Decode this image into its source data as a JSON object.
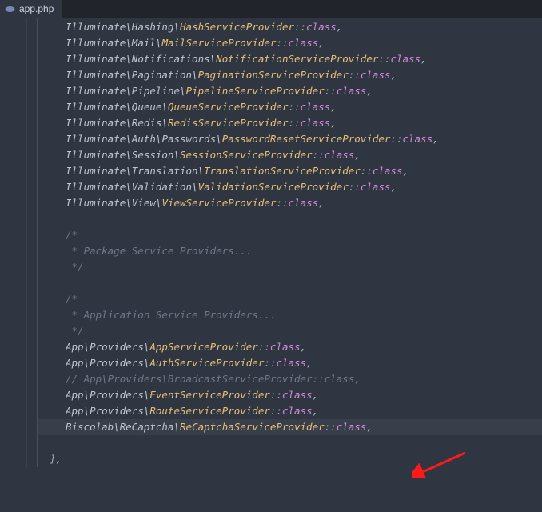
{
  "tab": {
    "filename": "app.php"
  },
  "lines": [
    {
      "ns": "Illuminate\\Hashing\\",
      "cls": "HashServiceProvider",
      "tail": "::",
      "kw": "class",
      "end": ","
    },
    {
      "ns": "Illuminate\\Mail\\",
      "cls": "MailServiceProvider",
      "tail": "::",
      "kw": "class",
      "end": ","
    },
    {
      "ns": "Illuminate\\Notifications\\",
      "cls": "NotificationServiceProvider",
      "tail": "::",
      "kw": "class",
      "end": ","
    },
    {
      "ns": "Illuminate\\Pagination\\",
      "cls": "PaginationServiceProvider",
      "tail": "::",
      "kw": "class",
      "end": ","
    },
    {
      "ns": "Illuminate\\Pipeline\\",
      "cls": "PipelineServiceProvider",
      "tail": "::",
      "kw": "class",
      "end": ","
    },
    {
      "ns": "Illuminate\\Queue\\",
      "cls": "QueueServiceProvider",
      "tail": "::",
      "kw": "class",
      "end": ","
    },
    {
      "ns": "Illuminate\\Redis\\",
      "cls": "RedisServiceProvider",
      "tail": "::",
      "kw": "class",
      "end": ","
    },
    {
      "ns": "Illuminate\\Auth\\Passwords\\",
      "cls": "PasswordResetServiceProvider",
      "tail": "::",
      "kw": "class",
      "end": ","
    },
    {
      "ns": "Illuminate\\Session\\",
      "cls": "SessionServiceProvider",
      "tail": "::",
      "kw": "class",
      "end": ","
    },
    {
      "ns": "Illuminate\\Translation\\",
      "cls": "TranslationServiceProvider",
      "tail": "::",
      "kw": "class",
      "end": ","
    },
    {
      "ns": "Illuminate\\Validation\\",
      "cls": "ValidationServiceProvider",
      "tail": "::",
      "kw": "class",
      "end": ","
    },
    {
      "ns": "Illuminate\\View\\",
      "cls": "ViewServiceProvider",
      "tail": "::",
      "kw": "class",
      "end": ","
    }
  ],
  "comment1": {
    "a": "/*",
    "b": " * Package Service Providers...",
    "c": " */"
  },
  "comment2": {
    "a": "/*",
    "b": " * Application Service Providers...",
    "c": " */"
  },
  "appLines": [
    {
      "ns": "App\\Providers\\",
      "cls": "AppServiceProvider",
      "tail": "::",
      "kw": "class",
      "end": ","
    },
    {
      "ns": "App\\Providers\\",
      "cls": "AuthServiceProvider",
      "tail": "::",
      "kw": "class",
      "end": ","
    }
  ],
  "commentedLine": "// App\\Providers\\BroadcastServiceProvider::class,",
  "appLines2": [
    {
      "ns": "App\\Providers\\",
      "cls": "EventServiceProvider",
      "tail": "::",
      "kw": "class",
      "end": ","
    },
    {
      "ns": "App\\Providers\\",
      "cls": "RouteServiceProvider",
      "tail": "::",
      "kw": "class",
      "end": ","
    },
    {
      "ns": "Biscolab\\ReCaptcha\\",
      "cls": "ReCaptchaServiceProvider",
      "tail": "::",
      "kw": "class",
      "end": ",",
      "hl": true,
      "cursor": true
    }
  ],
  "closeBracket": "],"
}
